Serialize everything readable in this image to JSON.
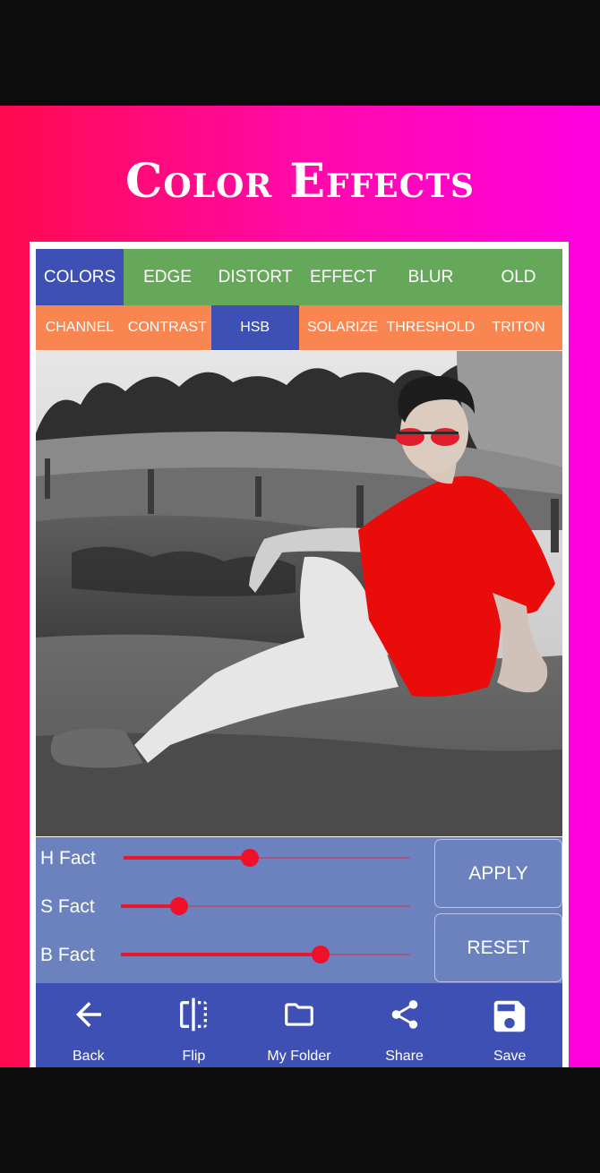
{
  "title": "Color Effects",
  "tabs_row1": [
    {
      "label": "COLORS",
      "active": true
    },
    {
      "label": "EDGE",
      "active": false
    },
    {
      "label": "DISTORT",
      "active": false
    },
    {
      "label": "EFFECT",
      "active": false
    },
    {
      "label": "BLUR",
      "active": false
    },
    {
      "label": "OLD",
      "active": false
    }
  ],
  "tabs_row2": [
    {
      "label": "CHANNEL",
      "active": false
    },
    {
      "label": "CONTRAST",
      "active": false
    },
    {
      "label": "HSB",
      "active": true
    },
    {
      "label": "SOLARIZE",
      "active": false
    },
    {
      "label": "THRESHOLD",
      "active": false
    },
    {
      "label": "TRITON",
      "active": false
    }
  ],
  "sliders": [
    {
      "label": "H Fact",
      "value": 0.44
    },
    {
      "label": "S Fact",
      "value": 0.2
    },
    {
      "label": "B Fact",
      "value": 0.69
    }
  ],
  "buttons": {
    "apply": "APPLY",
    "reset": "RESET"
  },
  "bottom_bar": [
    {
      "label": "Back",
      "icon": "arrow-back-icon"
    },
    {
      "label": "Flip",
      "icon": "flip-icon"
    },
    {
      "label": "My Folder",
      "icon": "folder-icon"
    },
    {
      "label": "Share",
      "icon": "share-icon"
    },
    {
      "label": "Save",
      "icon": "save-icon"
    }
  ],
  "colors": {
    "tab_row1": "#66a85a",
    "tab_row2": "#f98651",
    "active_tab": "#3f50b5",
    "controls": "#6c82bf",
    "slider": "#e8192f"
  }
}
